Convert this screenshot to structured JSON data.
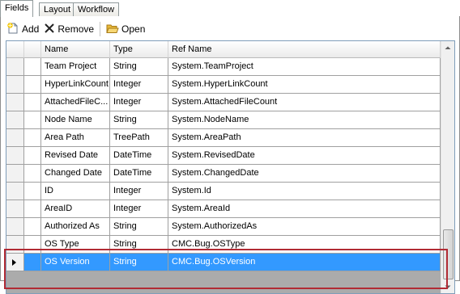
{
  "tabs": [
    {
      "label": "Fields",
      "active": true
    },
    {
      "label": "Layout",
      "active": false
    },
    {
      "label": "Workflow",
      "active": false
    }
  ],
  "toolbar": {
    "add_label": "Add",
    "remove_label": "Remove",
    "open_label": "Open"
  },
  "grid": {
    "columns": [
      "Name",
      "Type",
      "Ref Name"
    ],
    "rows": [
      {
        "name": "Team Project",
        "type": "String",
        "ref": "System.TeamProject"
      },
      {
        "name": "HyperLinkCount",
        "type": "Integer",
        "ref": "System.HyperLinkCount"
      },
      {
        "name": "AttachedFileC...",
        "type": "Integer",
        "ref": "System.AttachedFileCount"
      },
      {
        "name": "Node Name",
        "type": "String",
        "ref": "System.NodeName"
      },
      {
        "name": "Area Path",
        "type": "TreePath",
        "ref": "System.AreaPath"
      },
      {
        "name": "Revised Date",
        "type": "DateTime",
        "ref": "System.RevisedDate"
      },
      {
        "name": "Changed Date",
        "type": "DateTime",
        "ref": "System.ChangedDate"
      },
      {
        "name": "ID",
        "type": "Integer",
        "ref": "System.Id"
      },
      {
        "name": "AreaID",
        "type": "Integer",
        "ref": "System.AreaId"
      },
      {
        "name": "Authorized As",
        "type": "String",
        "ref": "System.AuthorizedAs"
      },
      {
        "name": "OS Type",
        "type": "String",
        "ref": "CMC.Bug.OSType"
      },
      {
        "name": "OS Version",
        "type": "String",
        "ref": "CMC.Bug.OSVersion",
        "selected": true
      }
    ]
  },
  "colors": {
    "selection": "#3399ff",
    "highlight_box": "#b12b34"
  },
  "icons": {
    "add": "add-document-icon",
    "remove": "x-icon",
    "open": "open-folder-icon"
  }
}
